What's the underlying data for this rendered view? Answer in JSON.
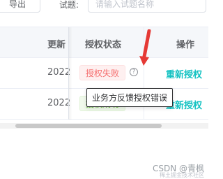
{
  "toolbar": {
    "export_label": "导出",
    "exam_label": "试题:",
    "exam_placeholder": "请输入试题名称"
  },
  "table": {
    "headers": {
      "update": "更新",
      "auth_status": "授权状态",
      "ops": "操作"
    },
    "rows": [
      {
        "date": "2022",
        "status": "授权失败",
        "status_type": "fail",
        "action": "重新授权"
      },
      {
        "date": "2022",
        "status": "授权成功",
        "status_type": "ok",
        "action": "重新授权"
      }
    ]
  },
  "tooltip": {
    "text": "业务方反馈授权错误"
  },
  "watermark": {
    "text": "CSDN @青枫",
    "sub": "稀土掘金技术社区"
  },
  "colors": {
    "arrow": "#e53935"
  }
}
